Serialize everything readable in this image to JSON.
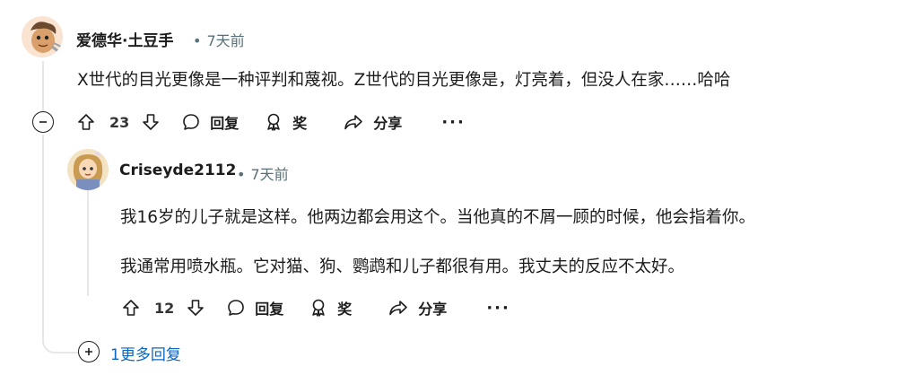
{
  "comments": [
    {
      "author": "爱德华·土豆手",
      "time": "7天前",
      "body": [
        "X世代的目光更像是一种评判和蔑视。Z世代的目光更像是，灯亮着，但没人在家……哈哈"
      ],
      "votes": "23",
      "actions": {
        "reply": "回复",
        "award": "奖",
        "share": "分享",
        "more": "···"
      }
    },
    {
      "author": "Criseyde2112",
      "time": "7天前",
      "body": [
        "我16岁的儿子就是这样。他两边都会用这个。当他真的不屑一顾的时候，他会指着你。",
        "我通常用喷水瓶。它对猫、狗、鹦鹉和儿子都很有用。我丈夫的反应不太好。"
      ],
      "votes": "12",
      "actions": {
        "reply": "回复",
        "award": "奖",
        "share": "分享",
        "more": "···"
      }
    }
  ],
  "more_replies": "1更多回复",
  "separator": "•",
  "colors": {
    "accent": "#0a66c2",
    "meta": "#576f76",
    "thread": "#e5e7eb"
  }
}
